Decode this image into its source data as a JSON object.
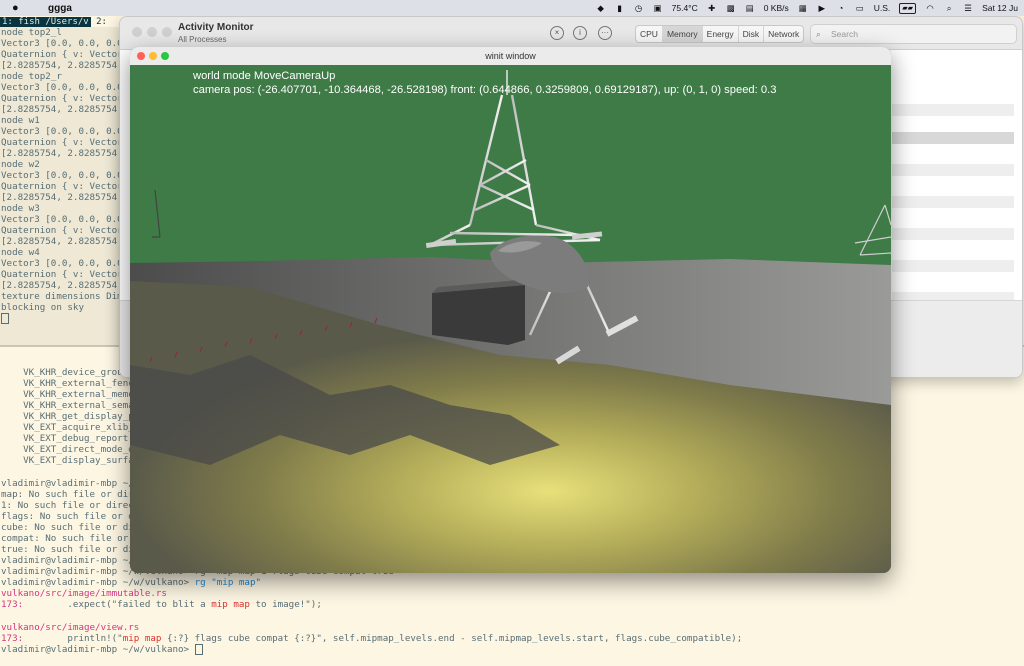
{
  "menubar": {
    "app_name": "ggga",
    "temperature": "75.4°C",
    "network_speed": "0 KB/s",
    "input_source": "U.S.",
    "datetime": "Sat 12 Ju"
  },
  "terminal": {
    "tab_1": "1: fish /Users/v",
    "tab_2": "2:",
    "top_lines": [
      "node top2_l",
      "Vector3 [0.0, 0.0, 0.0",
      "Quaternion { v: Vector",
      "[2.8285754, 2.8285754,",
      "node top2_r",
      "Vector3 [0.0, 0.0, 0.0",
      "Quaternion { v: Vector",
      "[2.8285754, 2.8285754,",
      "node w1",
      "Vector3 [0.0, 0.0, 0.0",
      "Quaternion { v: Vector",
      "[2.8285754, 2.8285754,",
      "node w2",
      "Vector3 [0.0, 0.0, 0.0",
      "Quaternion { v: Vector",
      "[2.8285754, 2.8285754,",
      "node w3",
      "Vector3 [0.0, 0.0, 0.0",
      "Quaternion { v: Vector",
      "[2.8285754, 2.8285754,",
      "node w4",
      "Vector3 [0.0, 0.0, 0.0",
      "Quaternion { v: Vector",
      "[2.8285754, 2.8285754,",
      "texture dimensions Dim",
      "blocking on sky"
    ],
    "extension_lines": [
      "    VK_KHR_device_group_",
      "    VK_KHR_external_fenc",
      "    VK_KHR_external_memo",
      "    VK_KHR_external_sema",
      "    VK_KHR_get_display_p",
      "    VK_EXT_acquire_xlib_",
      "    VK_EXT_debug_report",
      "    VK_EXT_direct_mode_d",
      "    VK_EXT_display_surfa"
    ],
    "error_lines": [
      "vladimir@vladimir-mbp ~/",
      "map: No such file or dir",
      "1: No such file or direc",
      "flags: No such file or d",
      "cube: No such file or di",
      "compat: No such file or",
      "true: No such file or di",
      "vladimir@vladimir-mbp ~/",
      "vladimir@vladimir-mbp ~/w/vulkano> rg \"mip map 1 flags cube compat true\""
    ],
    "rg_prompt": "vladimir@vladimir-mbp ~/w/vulkano>",
    "rg_command": "rg \"mip map\"",
    "file_1": "vulkano/src/image/immutable.rs",
    "file_1_line_num": "173:",
    "file_1_pre": "        .expect(\"failed to blit a ",
    "file_1_match": "mip map",
    "file_1_post": " to image!\");",
    "file_2": "vulkano/src/image/view.rs",
    "file_2_line_num": "173:",
    "file_2_pre": "        println!(\"",
    "file_2_match": "mip map",
    "file_2_post": " {:?} flags cube compat {:?}\", self.mipmap_levels.end - self.mipmap_levels.start, flags.cube_compatible);",
    "final_prompt": "vladimir@vladimir-mbp ~/w/vulkano>"
  },
  "activity_monitor": {
    "title": "Activity Monitor",
    "subtitle": "All Processes",
    "tabs": [
      "CPU",
      "Memory",
      "Energy",
      "Disk",
      "Network"
    ],
    "active_tab": "Memory",
    "search_placeholder": "Search"
  },
  "winit_window": {
    "title": "winit window",
    "hud_line_1": "world mode MoveCameraUp",
    "hud_line_2": "camera pos: (-26.407701, -10.364468, -26.528198) front: (0.644866, 0.3259809, 0.69129187), up: (0, 1, 0) speed: 0.3",
    "sky_color": "#3e7b46"
  }
}
